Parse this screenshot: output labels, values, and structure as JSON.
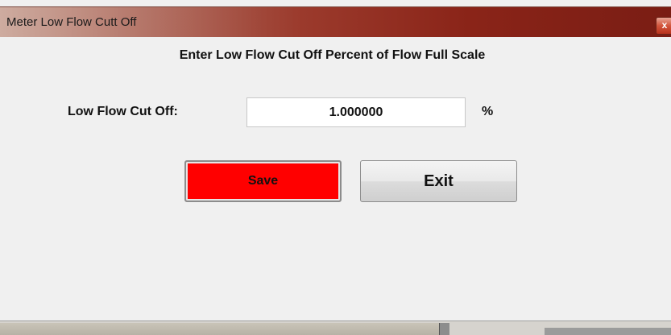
{
  "window": {
    "title": "Meter Low Flow Cutt Off",
    "close_symbol": "x"
  },
  "dialog": {
    "instruction": "Enter Low Flow Cut Off Percent of Flow Full Scale",
    "field_label": "Low Flow Cut Off:",
    "value": "1.000000",
    "unit": "%"
  },
  "buttons": {
    "save_label": "Save",
    "save_color": "#ff0000",
    "exit_label": "Exit"
  },
  "icons": {
    "close": "close-icon"
  }
}
